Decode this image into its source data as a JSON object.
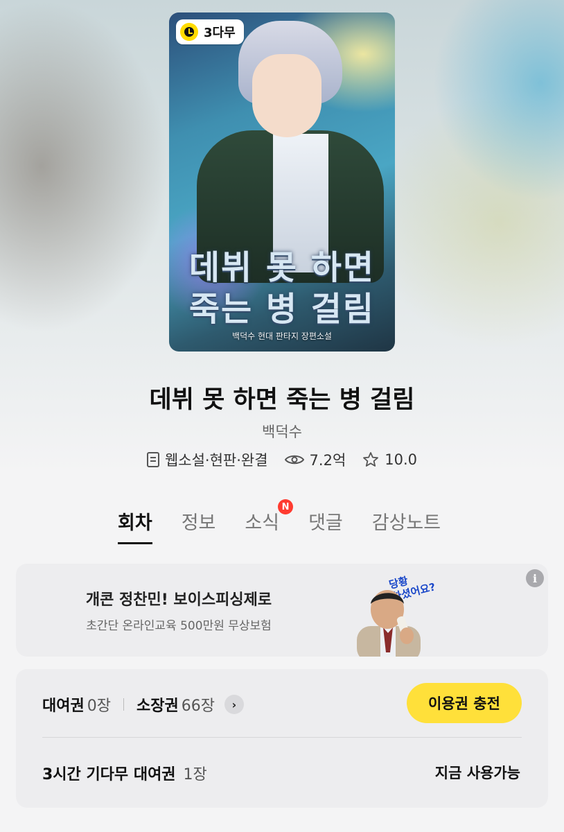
{
  "cover": {
    "badge": "3다무",
    "title_line1": "데뷔 못 하면",
    "title_line2": "죽는 병 걸림",
    "subtitle": "백덕수 현대 판타지 장편소설"
  },
  "work": {
    "title": "데뷔 못 하면 죽는 병 걸림",
    "author": "백덕수",
    "genre": "웹소설·현판·완결",
    "views": "7.2억",
    "rating": "10.0"
  },
  "tabs": [
    {
      "label": "회차",
      "active": true
    },
    {
      "label": "정보"
    },
    {
      "label": "소식",
      "badge": "N"
    },
    {
      "label": "댓글"
    },
    {
      "label": "감상노트"
    }
  ],
  "ad": {
    "title": "개콘 정찬민! 보이스피싱제로",
    "subtitle": "초간단 온라인교육 500만원 무상보험",
    "bubble_line1": "당황",
    "bubble_line2": "하셨어요?",
    "info": "i"
  },
  "pass": {
    "rental_label": "대여권",
    "rental_count": "0장",
    "owned_label": "소장권",
    "owned_count": "66장",
    "charge_button": "이용권 충전",
    "wait_label": "3시간 기다무 대여권",
    "wait_count": "1장",
    "wait_status": "지금 사용가능"
  },
  "colors": {
    "accent_yellow": "#ffe03a",
    "badge_red": "#ff3b30"
  }
}
